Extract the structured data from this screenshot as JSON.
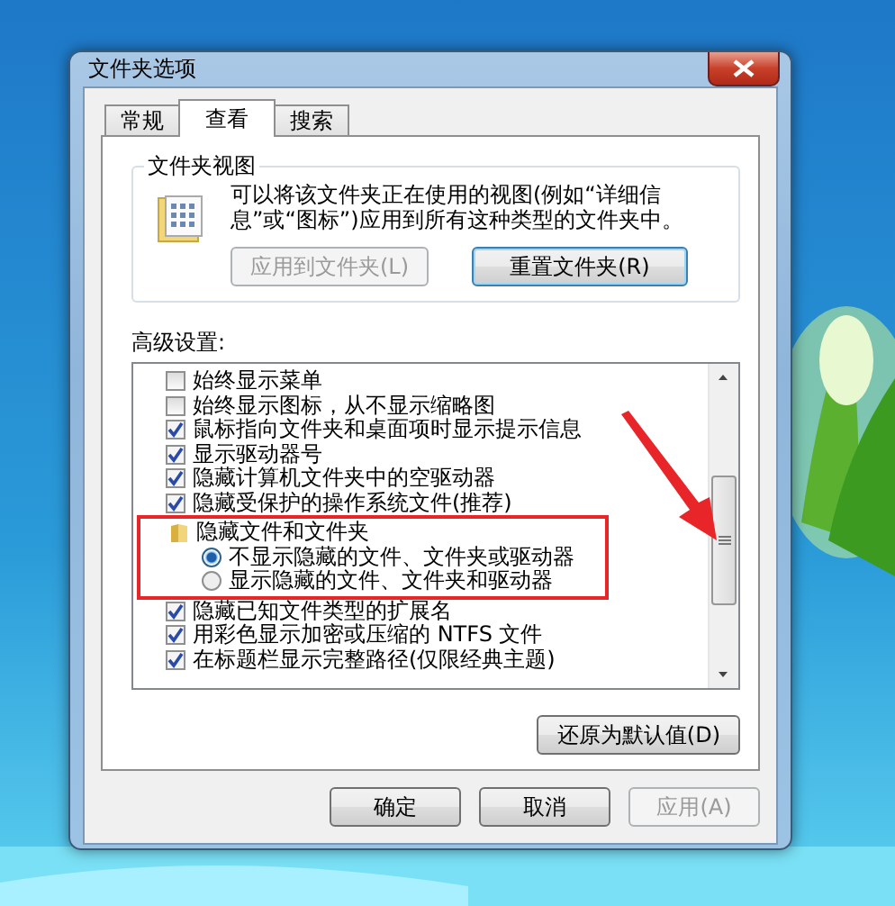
{
  "window": {
    "title": "文件夹选项"
  },
  "tabs": [
    {
      "label": "常规",
      "selected": false
    },
    {
      "label": "查看",
      "selected": true
    },
    {
      "label": "搜索",
      "selected": false
    }
  ],
  "folder_views": {
    "title": "文件夹视图",
    "description": "可以将该文件夹正在使用的视图(例如“详细信息”或“图标”)应用到所有这种类型的文件夹中。",
    "buttons": [
      {
        "label": "应用到文件夹(L)",
        "disabled": true
      },
      {
        "label": "重置文件夹(R)",
        "disabled": false
      }
    ]
  },
  "advanced": {
    "label": "高级设置:",
    "items": [
      {
        "kind": "checkbox",
        "label": "始终显示菜单",
        "checked": false
      },
      {
        "kind": "checkbox",
        "label": "始终显示图标，从不显示缩略图",
        "checked": false
      },
      {
        "kind": "checkbox",
        "label": "鼠标指向文件夹和桌面项时显示提示信息",
        "checked": true
      },
      {
        "kind": "checkbox",
        "label": "显示驱动器号",
        "checked": true
      },
      {
        "kind": "checkbox",
        "label": "隐藏计算机文件夹中的空驱动器",
        "checked": true
      },
      {
        "kind": "checkbox",
        "label": "隐藏受保护的操作系统文件(推荐)",
        "checked": true
      },
      {
        "kind": "folder",
        "label": "隐藏文件和文件夹",
        "children": [
          {
            "kind": "radio",
            "label": "不显示隐藏的文件、文件夹或驱动器",
            "selected": true
          },
          {
            "kind": "radio",
            "label": "显示隐藏的文件、文件夹和驱动器",
            "selected": false
          }
        ]
      },
      {
        "kind": "checkbox",
        "label": "隐藏已知文件类型的扩展名",
        "checked": true
      },
      {
        "kind": "checkbox",
        "label": "用彩色显示加密或压缩的 NTFS 文件",
        "checked": true
      },
      {
        "kind": "checkbox",
        "label": "在标题栏显示完整路径(仅限经典主题)",
        "checked": true
      }
    ]
  },
  "restore_button": {
    "label": "还原为默认值(D)"
  },
  "buttons": [
    {
      "label": "确定",
      "disabled": false
    },
    {
      "label": "取消",
      "disabled": false
    },
    {
      "label": "应用(A)",
      "disabled": true
    }
  ]
}
